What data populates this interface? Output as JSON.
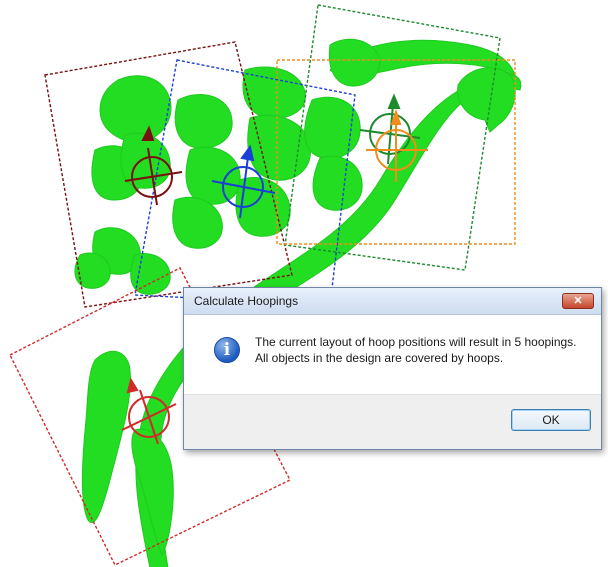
{
  "dialog": {
    "title": "Calculate Hoopings",
    "close_glyph": "✕",
    "icon": "information-icon",
    "message_line1": "The current layout of hoop positions will result in 5 hoopings.",
    "message_line2": "All objects in the design are covered by hoops.",
    "ok_label": "OK"
  },
  "colors": {
    "embroidery_green": "#22dd22",
    "hoop_dark_red": "#7a1010",
    "hoop_blue": "#1b3fd6",
    "hoop_green": "#1e8a2e",
    "hoop_orange": "#f28c1a",
    "hoop_red": "#d12a2a"
  }
}
